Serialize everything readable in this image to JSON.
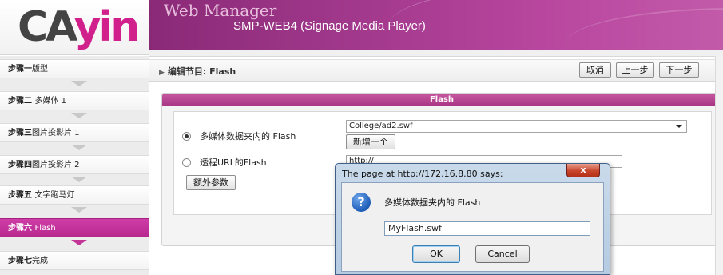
{
  "header": {
    "logo_main": "CA",
    "logo_accent": "yin",
    "title": "Web Manager",
    "subtitle": "SMP-WEB4 (Signage Media Player)"
  },
  "sidebar": {
    "items": [
      {
        "step": "步骤一",
        "label": "版型",
        "active": false
      },
      {
        "step": "步骤二",
        "label": "多媒体 1",
        "active": false
      },
      {
        "step": "步骤三",
        "label": "图片投影片 1",
        "active": false
      },
      {
        "step": "步骤四",
        "label": "图片投影片 2",
        "active": false
      },
      {
        "step": "步骤五",
        "label": "文字跑马灯",
        "active": false
      },
      {
        "step": "步骤六",
        "label": "Flash",
        "active": true
      },
      {
        "step": "步骤七",
        "label": "完成",
        "active": false
      }
    ]
  },
  "toolbar": {
    "breadcrumb": "编辑节目: Flash",
    "cancel_label": "取消",
    "prev_label": "上一步",
    "next_label": "下一步"
  },
  "panel": {
    "title": "Flash",
    "option_local_label": "多媒体数据夹内的 Flash",
    "option_remote_label": "透程URL的Flash",
    "selected_file": "College/ad2.swf",
    "add_new_label": "新增一个",
    "url_value": "http://",
    "extra_params_label": "额外参数"
  },
  "dialog": {
    "title": "The page at http://172.16.8.80 says:",
    "close_label": "x",
    "message": "多媒体数据夹内的 Flash",
    "input_value": "MyFlash.swf",
    "ok_label": "OK",
    "cancel_label": "Cancel"
  },
  "colors": {
    "brand_magenta": "#b7288f",
    "header_purple": "#8a2a77"
  }
}
